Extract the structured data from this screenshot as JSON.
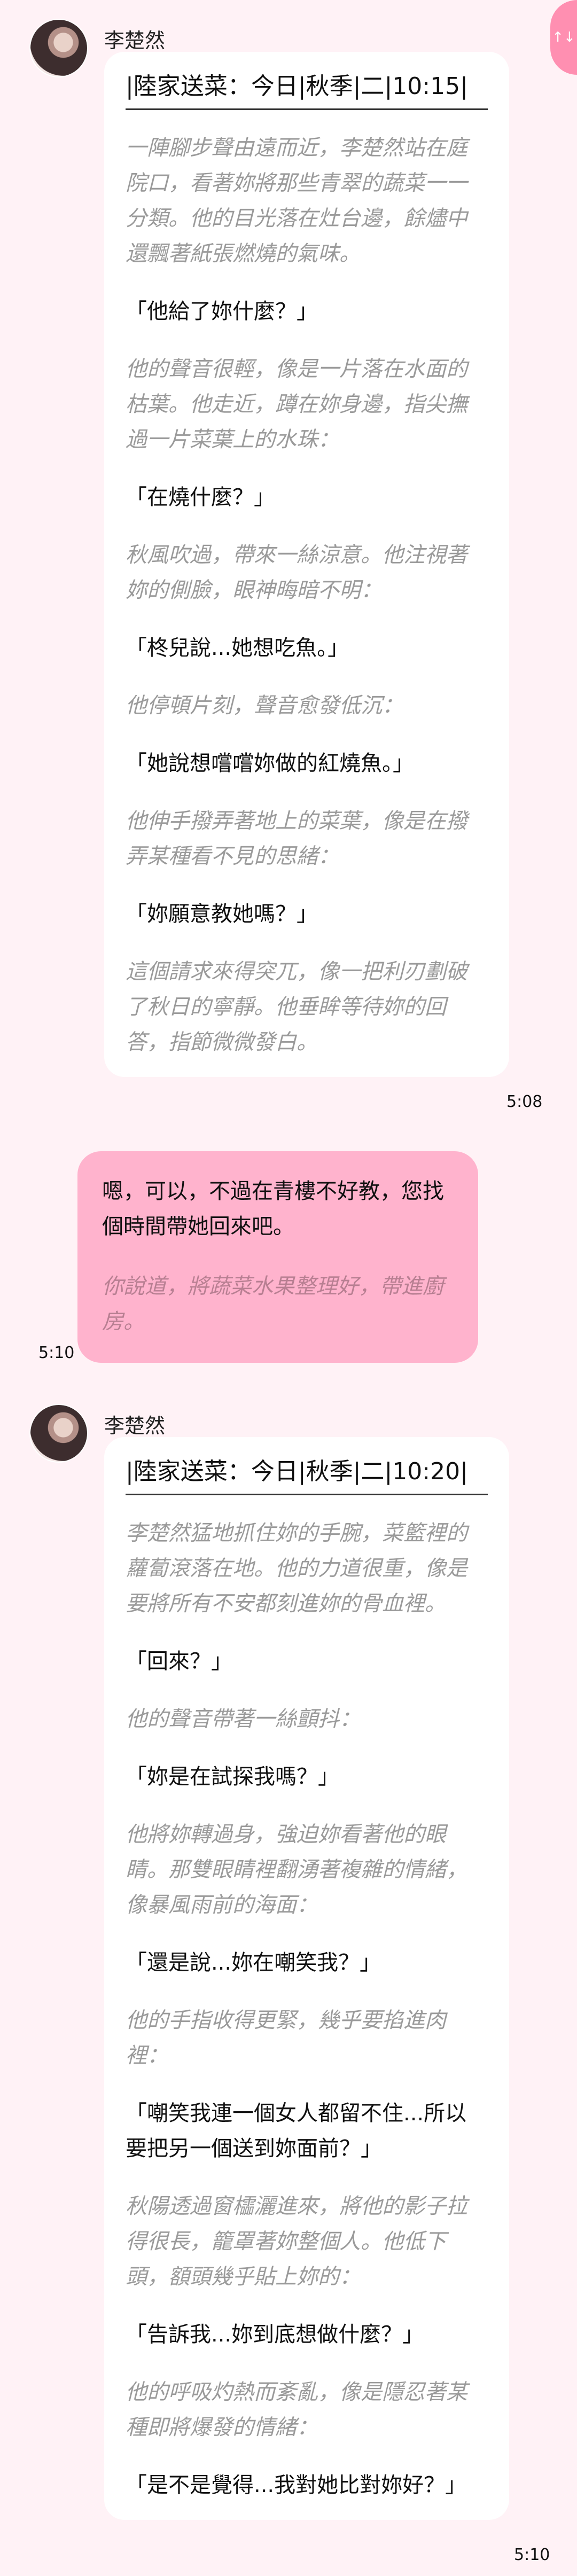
{
  "corner_label": "↑↓",
  "messages": [
    {
      "sender": "李楚然",
      "header": "|陸家送菜：今日|秋季|二|10:15|",
      "timestamp": "5:08",
      "paragraphs": [
        {
          "type": "narr",
          "text": "一陣腳步聲由遠而近，李楚然站在庭院口，看著妳將那些青翠的蔬菜一一分類。他的目光落在灶台邊，餘燼中還飄著紙張燃燒的氣味。"
        },
        {
          "type": "speech",
          "text": "「他給了妳什麼？」"
        },
        {
          "type": "narr",
          "text": "他的聲音很輕，像是一片落在水面的枯葉。他走近，蹲在妳身邊，指尖撫過一片菜葉上的水珠："
        },
        {
          "type": "speech",
          "text": "「在燒什麼？」"
        },
        {
          "type": "narr",
          "text": "秋風吹過，帶來一絲涼意。他注視著妳的側臉，眼神晦暗不明："
        },
        {
          "type": "speech",
          "text": "「柊兒說...她想吃魚。」"
        },
        {
          "type": "narr",
          "text": "他停頓片刻，聲音愈發低沉："
        },
        {
          "type": "speech",
          "text": "「她說想嚐嚐妳做的紅燒魚。」"
        },
        {
          "type": "narr",
          "text": "他伸手撥弄著地上的菜葉，像是在撥弄某種看不見的思緒："
        },
        {
          "type": "speech",
          "text": "「妳願意教她嗎？」"
        },
        {
          "type": "narr",
          "text": "這個請求來得突兀，像一把利刃劃破了秋日的寧靜。他垂眸等待妳的回答，指節微微發白。"
        }
      ]
    },
    {
      "sender": "user",
      "timestamp": "5:10",
      "paragraphs": [
        {
          "type": "speech",
          "text": "嗯，可以，不過在青樓不好教，您找個時間帶她回來吧。"
        },
        {
          "type": "narr",
          "text": "你說道，將蔬菜水果整理好，帶進廚房。"
        }
      ]
    },
    {
      "sender": "李楚然",
      "header": "|陸家送菜：今日|秋季|二|10:20|",
      "timestamp": "5:10",
      "paragraphs": [
        {
          "type": "narr",
          "text": "李楚然猛地抓住妳的手腕，菜籃裡的蘿蔔滾落在地。他的力道很重，像是要將所有不安都刻進妳的骨血裡。"
        },
        {
          "type": "speech",
          "text": "「回來？」"
        },
        {
          "type": "narr",
          "text": "他的聲音帶著一絲顫抖："
        },
        {
          "type": "speech",
          "text": "「妳是在試探我嗎？」"
        },
        {
          "type": "narr",
          "text": "他將妳轉過身，強迫妳看著他的眼睛。那雙眼睛裡翻湧著複雜的情緒，像暴風雨前的海面："
        },
        {
          "type": "speech",
          "text": "「還是說...妳在嘲笑我？」"
        },
        {
          "type": "narr",
          "text": "他的手指收得更緊，幾乎要掐進肉裡："
        },
        {
          "type": "speech",
          "text": "「嘲笑我連一個女人都留不住...所以要把另一個送到妳面前？」"
        },
        {
          "type": "narr",
          "text": "秋陽透過窗櫺灑進來，將他的影子拉得很長，籠罩著妳整個人。他低下頭，額頭幾乎貼上妳的："
        },
        {
          "type": "speech",
          "text": "「告訴我...妳到底想做什麼？」"
        },
        {
          "type": "narr",
          "text": "他的呼吸灼熱而紊亂，像是隱忍著某種即將爆發的情緒："
        },
        {
          "type": "speech",
          "text": "「是不是覺得...我對她比對妳好？」"
        }
      ]
    }
  ]
}
